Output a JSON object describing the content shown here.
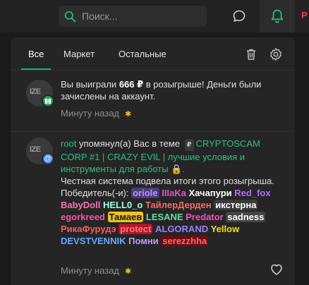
{
  "header": {
    "search_placeholder": "Поиск...",
    "edge_text": "Р"
  },
  "tabs": [
    {
      "label": "Все"
    },
    {
      "label": "Маркет"
    },
    {
      "label": "Остальные"
    }
  ],
  "notifications": [
    {
      "avatar_text": "IZE",
      "text_prefix": "Вы выиграли ",
      "amount": "666 ₽",
      "text_suffix": " в розыгрыше! Деньги были зачислены на аккаунт.",
      "time": "Минуту назад"
    },
    {
      "avatar_text": "IZE",
      "user": "root",
      "action": " упомянул(а) Вас в теме ",
      "prefix_badge": "₽",
      "thread": "CRYPTOSCAM CORP #1 | CRAZY EVIL | лучшие условия и инструменты для работы 🔒.",
      "body": "Честная система подвела итоги этого розыгрыша. Победитель(-и): ",
      "winners": [
        {
          "name": "oriole",
          "color": "#b892ff",
          "bg": "#4a3a7a"
        },
        {
          "name": "IIIaKa",
          "color": "#e055c8",
          "bg": ""
        },
        {
          "name": "Хачапури",
          "color": "#ffffff",
          "bg": ""
        },
        {
          "name": "Red_fox",
          "color": "#b56cff",
          "bg": ""
        },
        {
          "name": "BabyDoll",
          "color": "#ff6fb5",
          "bg": ""
        },
        {
          "name": "HELL0_o",
          "color": "#9effe0",
          "bg": ""
        },
        {
          "name": "ТайлерДерден",
          "color": "#ff6666",
          "bg": ""
        },
        {
          "name": "икстерна",
          "color": "#ffffff",
          "bg": "#3a3a3a"
        },
        {
          "name": "egorkreed",
          "color": "#ff4fa8",
          "bg": ""
        },
        {
          "name": "Тамаев",
          "color": "#111111",
          "bg": "#f0c419"
        },
        {
          "name": "LESANE",
          "color": "#5fe0a0",
          "bg": ""
        },
        {
          "name": "Predator",
          "color": "#ff4fc0",
          "bg": ""
        },
        {
          "name": "sadness",
          "color": "#ffffff",
          "bg": "#444"
        },
        {
          "name": "РикаФурудэ",
          "color": "#ff5a5a",
          "bg": ""
        },
        {
          "name": "protect",
          "color": "#ff7a7a",
          "bg": "#b0152a"
        },
        {
          "name": "ALGORAND",
          "color": "#a080ff",
          "bg": ""
        },
        {
          "name": "Yellow",
          "color": "#f5e000",
          "bg": ""
        },
        {
          "name": "DEVSTVENNIK",
          "color": "#63a9ff",
          "bg": ""
        },
        {
          "name": "Помни",
          "color": "#c59cff",
          "bg": ""
        },
        {
          "name": "serezzhha",
          "color": "#ff6b6b",
          "bg": "#6a0d12"
        }
      ],
      "time": "Минуту назад"
    }
  ]
}
